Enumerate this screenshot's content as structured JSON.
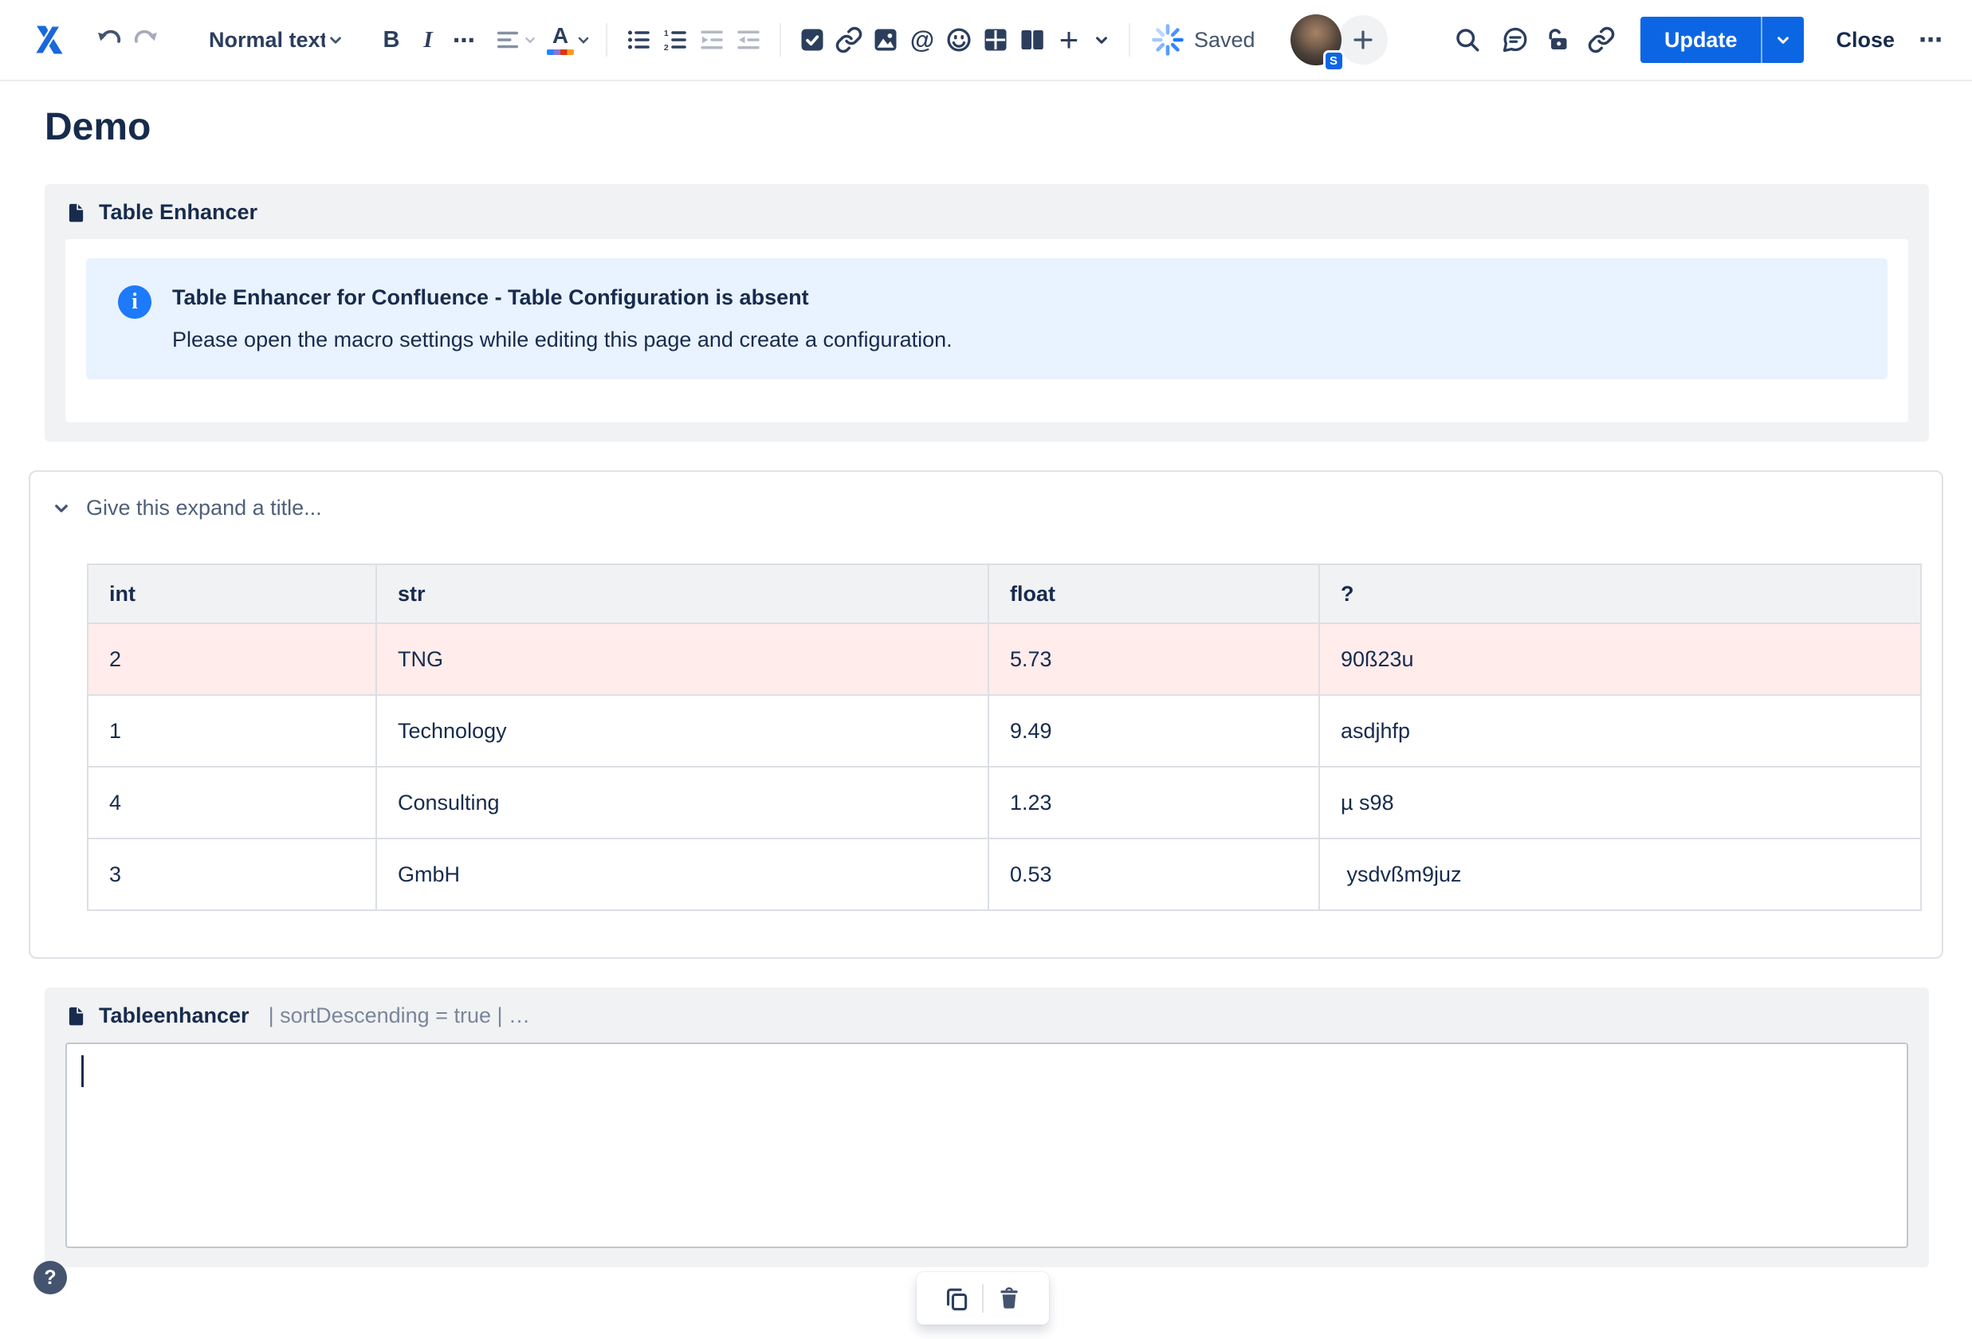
{
  "colors": {
    "accent_blue": "#0C66E4",
    "info_panel_bg": "#E9F2FF",
    "info_icon_blue": "#1D7AFC",
    "highlighted_row_bg": "#FFECEB",
    "macro_panel_bg": "#F1F2F4",
    "text_dark": "#172B4D",
    "text_gray": "#7A869A"
  },
  "toolbar": {
    "text_style_label": "Normal text",
    "bold_label": "B",
    "italic_label": "I",
    "more_formatting_label": "⋯",
    "mention_glyph": "@",
    "plus_glyph": "+",
    "status_saved": "Saved",
    "avatar_badge": "S",
    "update_label": "Update",
    "close_label": "Close",
    "overflow_label": "⋯"
  },
  "page": {
    "title": "Demo"
  },
  "table_enhancer_macro": {
    "name": "Table Enhancer",
    "info": {
      "title": "Table Enhancer for Confluence - Table Configuration is absent",
      "message": "Please open the macro settings while editing this page and create a configuration."
    }
  },
  "expand": {
    "title_placeholder": "Give this expand a title...",
    "table": {
      "headers": [
        "int",
        "str",
        "float",
        "?"
      ],
      "rows": [
        {
          "cells": [
            "2",
            "TNG",
            "5.73",
            "90ß23u"
          ],
          "highlighted": true
        },
        {
          "cells": [
            "1",
            "Technology",
            "9.49",
            "asdjhfp"
          ],
          "highlighted": false
        },
        {
          "cells": [
            "4",
            "Consulting",
            "1.23",
            "µ s98"
          ],
          "highlighted": false
        },
        {
          "cells": [
            "3",
            "GmbH",
            "0.53",
            " ysdvßm9juz"
          ],
          "highlighted": false
        }
      ]
    }
  },
  "tableenhancer_macro": {
    "name": "Tableenhancer",
    "params": "| sortDescending = true | …",
    "body_text": ""
  },
  "help_button": {
    "label": "?"
  }
}
